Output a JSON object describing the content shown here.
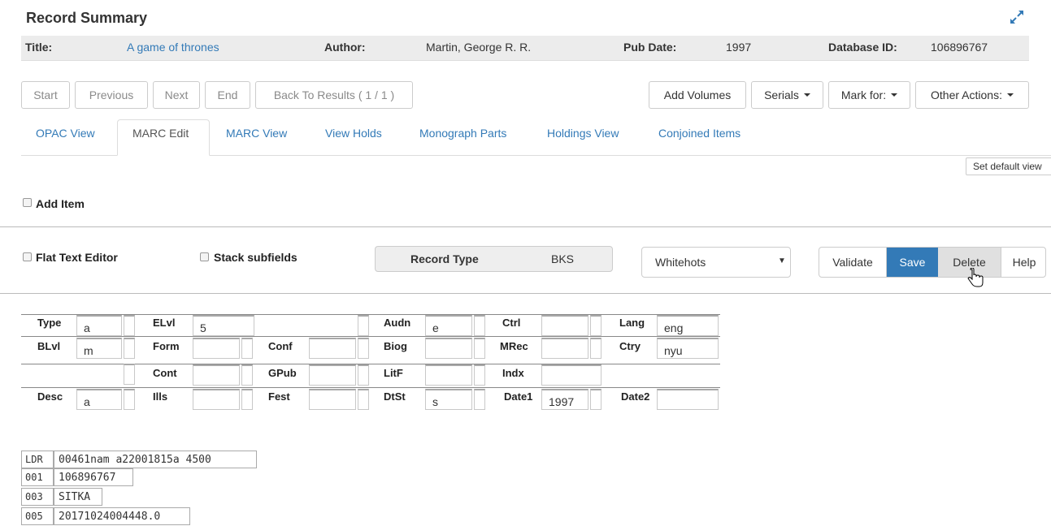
{
  "summary": {
    "heading": "Record Summary",
    "title_label": "Title:",
    "title_value": "A game of thrones",
    "author_label": "Author:",
    "author_value": "Martin, George R. R.",
    "pubdate_label": "Pub Date:",
    "pubdate_value": "1997",
    "dbid_label": "Database ID:",
    "dbid_value": "106896767"
  },
  "nav": {
    "start": "Start",
    "previous": "Previous",
    "next": "Next",
    "end": "End",
    "back": "Back To Results ( 1 / 1 )",
    "add_volumes": "Add Volumes",
    "serials": "Serials",
    "mark_for": "Mark for:",
    "other_actions": "Other Actions:"
  },
  "tabs": [
    "OPAC View",
    "MARC Edit",
    "MARC View",
    "View Holds",
    "Monograph Parts",
    "Holdings View",
    "Conjoined Items"
  ],
  "set_default_view": "Set default view",
  "add_item": "Add Item",
  "editor": {
    "flat_text": "Flat Text Editor",
    "stack_subfields": "Stack subfields",
    "record_type_label": "Record Type",
    "record_type_value": "BKS",
    "template_select": "Whitehots",
    "validate": "Validate",
    "save": "Save",
    "delete": "Delete",
    "help": "Help"
  },
  "fixed_fields": {
    "type": {
      "label": "Type",
      "value": "a"
    },
    "elvl": {
      "label": "ELvl",
      "value": "5"
    },
    "audn": {
      "label": "Audn",
      "value": "e"
    },
    "ctrl": {
      "label": "Ctrl",
      "value": ""
    },
    "lang": {
      "label": "Lang",
      "value": "eng"
    },
    "blvl": {
      "label": "BLvl",
      "value": "m"
    },
    "form": {
      "label": "Form",
      "value": ""
    },
    "conf": {
      "label": "Conf",
      "value": ""
    },
    "biog": {
      "label": "Biog",
      "value": ""
    },
    "mrec": {
      "label": "MRec",
      "value": ""
    },
    "ctry": {
      "label": "Ctry",
      "value": "nyu"
    },
    "cont": {
      "label": "Cont",
      "value": ""
    },
    "gpub": {
      "label": "GPub",
      "value": ""
    },
    "litf": {
      "label": "LitF",
      "value": ""
    },
    "indx": {
      "label": "Indx",
      "value": ""
    },
    "desc": {
      "label": "Desc",
      "value": "a"
    },
    "ills": {
      "label": "Ills",
      "value": ""
    },
    "fest": {
      "label": "Fest",
      "value": ""
    },
    "dtst": {
      "label": "DtSt",
      "value": "s"
    },
    "date1": {
      "label": "Date1",
      "value": "1997"
    },
    "date2": {
      "label": "Date2",
      "value": ""
    }
  },
  "marc": [
    {
      "tag": "LDR",
      "value": "00461nam a22001815a 4500"
    },
    {
      "tag": "001",
      "value": "106896767"
    },
    {
      "tag": "003",
      "value": "SITKA"
    },
    {
      "tag": "005",
      "value": "20171024004448.0"
    }
  ]
}
